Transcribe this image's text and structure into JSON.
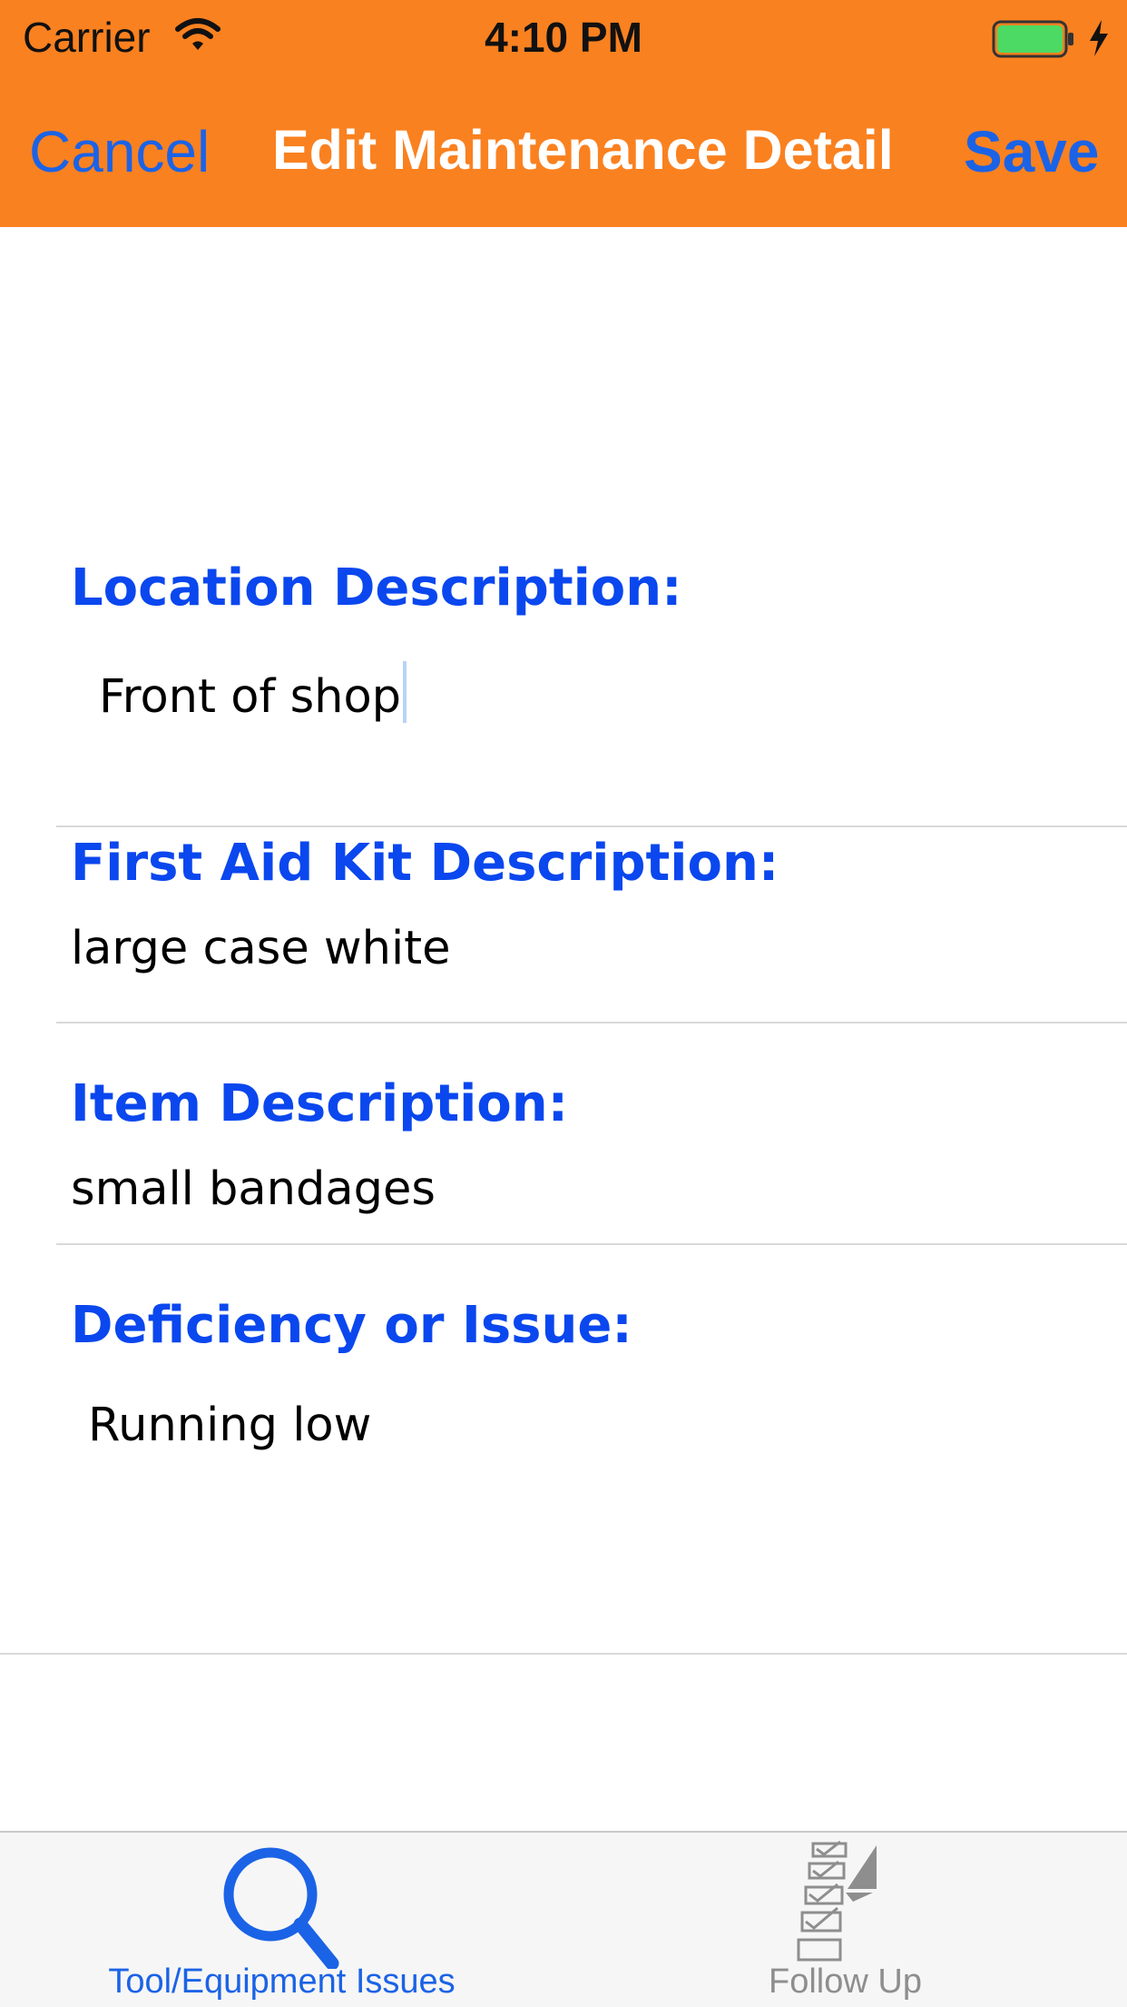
{
  "status_bar": {
    "carrier": "Carrier",
    "time": "4:10 PM",
    "wifi_icon": "wifi-icon",
    "battery_icon": "battery-icon",
    "charging_icon": "bolt-icon"
  },
  "nav_bar": {
    "background": "#fa8120",
    "cancel_label": "Cancel",
    "title": "Edit Maintenance Detail",
    "save_label": "Save"
  },
  "form": {
    "location": {
      "label": "Location Description:",
      "value": "Front of shop"
    },
    "kit": {
      "label": "First Aid Kit Description:",
      "value": "large case white"
    },
    "item": {
      "label": "Item Description:",
      "value": "small bandages"
    },
    "issue": {
      "label": "Deficiency or Issue:",
      "value": "Running low"
    }
  },
  "tab_bar": {
    "tabs": [
      {
        "label": "Tool/Equipment Issues",
        "icon": "magnifier-icon",
        "selected": true,
        "color": "#1b63e6"
      },
      {
        "label": "Follow Up",
        "icon": "checklist-icon",
        "selected": false,
        "color": "#8e8e8e"
      }
    ]
  },
  "colors": {
    "label_blue": "#0a47ee",
    "link_blue": "#1b63e6"
  }
}
